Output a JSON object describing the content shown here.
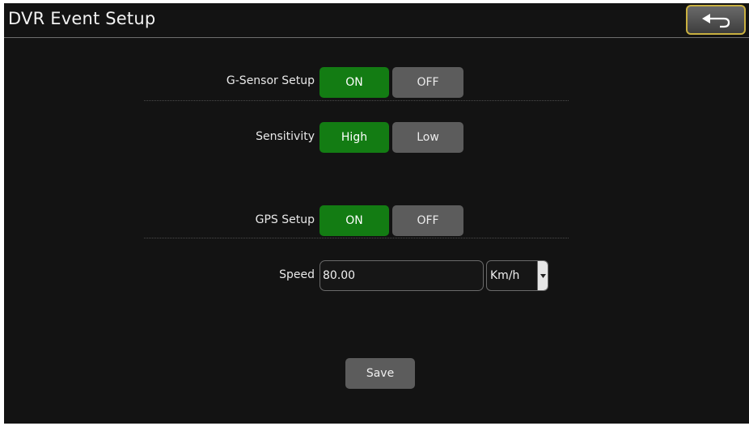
{
  "header": {
    "title": "DVR Event Setup",
    "back_icon": "return-arrow-icon"
  },
  "gsensor": {
    "label": "G-Sensor Setup",
    "on_label": "ON",
    "off_label": "OFF",
    "selected": "ON"
  },
  "sensitivity": {
    "label": "Sensitivity",
    "high_label": "High",
    "low_label": "Low",
    "selected": "High"
  },
  "gps": {
    "label": "GPS Setup",
    "on_label": "ON",
    "off_label": "OFF",
    "selected": "ON"
  },
  "speed": {
    "label": "Speed",
    "value": "80.00",
    "unit": "Km/h"
  },
  "save_label": "Save",
  "colors": {
    "background": "#131313",
    "selected": "#137c13",
    "unselected": "#5c5c5c",
    "back_border": "#c9b040"
  }
}
